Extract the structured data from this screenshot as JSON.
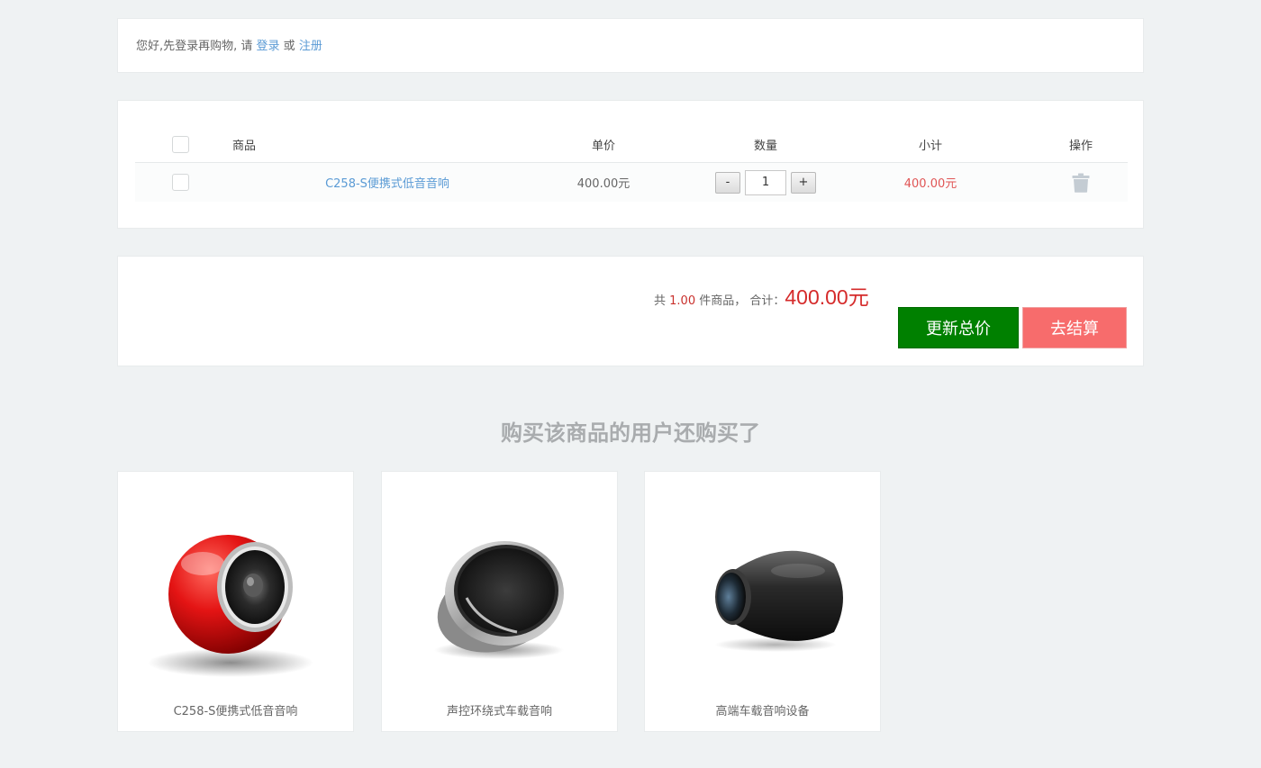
{
  "notice": {
    "text_prefix": "您好,先登录再购物, 请 ",
    "login_link": "登录",
    "or_text": " 或 ",
    "register_link": "注册"
  },
  "cart": {
    "columns": {
      "product": "商品",
      "price": "单价",
      "quantity": "数量",
      "subtotal": "小计",
      "action": "操作"
    },
    "items": [
      {
        "name": "C258-S便携式低音音响",
        "price": "400.00元",
        "quantity": "1",
        "subtotal": "400.00元",
        "minus": "-",
        "plus": "+"
      }
    ]
  },
  "summary": {
    "prefix": "共 ",
    "count": "1.00",
    "middle": " 件商品，  合计：",
    "total": "400.00元",
    "update_label": "更新总价",
    "checkout_label": "去结算"
  },
  "recommend": {
    "title": "购买该商品的用户还购买了",
    "items": [
      {
        "name": "C258-S便携式低音音响",
        "icon": "red-speaker-image"
      },
      {
        "name": "声控环绕式车载音响",
        "icon": "silver-speaker-image"
      },
      {
        "name": "高端车载音响设备",
        "icon": "black-speaker-image"
      }
    ]
  },
  "colors": {
    "link": "#5b9bd5",
    "price_red": "#e05555",
    "update_green": "#008000",
    "checkout_pink": "#f76c6c"
  }
}
